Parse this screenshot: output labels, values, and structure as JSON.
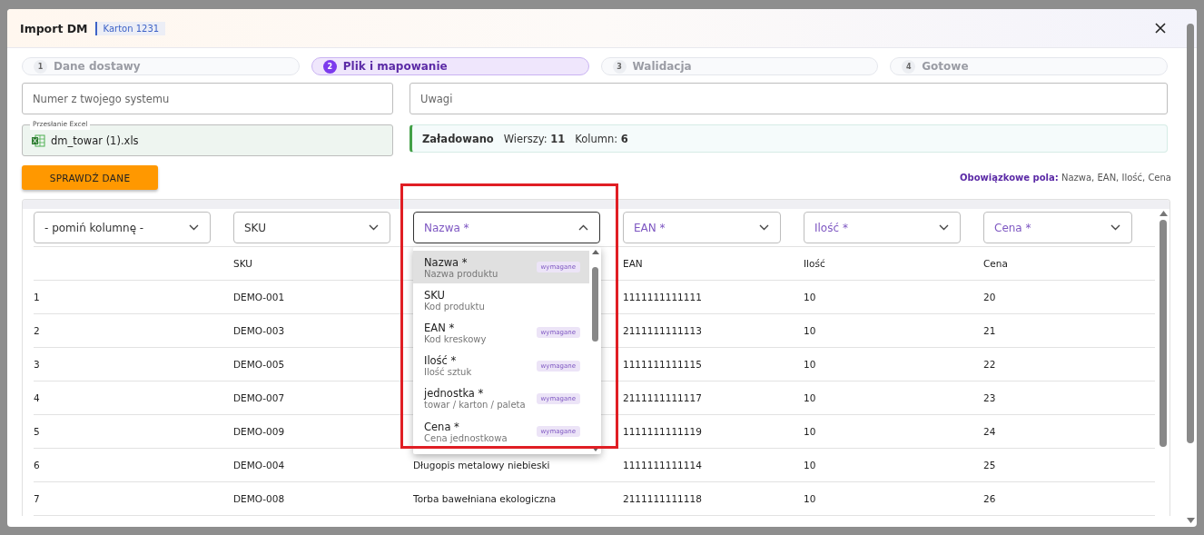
{
  "dialog": {
    "title": "Import DM",
    "badge": "Karton 1231"
  },
  "steps": [
    {
      "number": "1",
      "label": "Dane dostawy",
      "selected": false
    },
    {
      "number": "2",
      "label": "Plik i mapowanie",
      "selected": true
    },
    {
      "number": "3",
      "label": "Walidacja",
      "selected": false
    },
    {
      "number": "4",
      "label": "Gotowe",
      "selected": false
    }
  ],
  "order_number": {
    "placeholder": "Numer z twojego systemu"
  },
  "notes": {
    "placeholder": "Uwagi"
  },
  "upload": {
    "legend": "Przesłanie Excel",
    "filename": "dm_towar (1).xls"
  },
  "status": {
    "label": "Załadowano",
    "rows_label": "Wierszy:",
    "rows": "11",
    "cols_label": "Kolumn:",
    "cols": "6"
  },
  "check_button": "SPRAWDŹ DANE",
  "required_note": {
    "label": "Obowiązkowe pola:",
    "fields": "Nazwa, EAN, Ilość, Cena"
  },
  "mapping": [
    {
      "value": "- pomiń kolumnę -",
      "required": false,
      "expanded": false
    },
    {
      "value": "SKU",
      "required": false,
      "expanded": false,
      "header": "SKU"
    },
    {
      "value": "Nazwa *",
      "required": true,
      "expanded": true
    },
    {
      "value": "EAN *",
      "required": true,
      "expanded": false,
      "header": "EAN"
    },
    {
      "value": "Ilość *",
      "required": true,
      "expanded": false,
      "header": "Ilość"
    },
    {
      "value": "Cena *",
      "required": true,
      "expanded": false,
      "header": "Cena"
    }
  ],
  "dropdown_options": [
    {
      "label": "Nazwa *",
      "hint": "Nazwa produktu",
      "badge": "wymagane",
      "selected": true
    },
    {
      "label": "SKU",
      "hint": "Kod produktu",
      "selected": false
    },
    {
      "label": "EAN *",
      "hint": "Kod kreskowy",
      "badge": "wymagane",
      "selected": false
    },
    {
      "label": "Ilość *",
      "hint": "Ilość sztuk",
      "badge": "wymagane",
      "selected": false
    },
    {
      "label": "jednostka *",
      "hint": "towar / karton / paleta",
      "badge": "wymagane",
      "selected": false
    },
    {
      "label": "Cena *",
      "hint": "Cena jednostkowa",
      "badge": "wymagane",
      "selected": false
    }
  ],
  "table": {
    "rows": [
      [
        "1",
        "DEMO-001",
        "",
        "1111111111111",
        "10",
        "20"
      ],
      [
        "2",
        "DEMO-003",
        "",
        "2111111111113",
        "10",
        "21"
      ],
      [
        "3",
        "DEMO-005",
        "",
        "1111111111115",
        "10",
        "22"
      ],
      [
        "4",
        "DEMO-007",
        "",
        "2111111111117",
        "10",
        "23"
      ],
      [
        "5",
        "DEMO-009",
        "",
        "1111111111119",
        "10",
        "24"
      ],
      [
        "6",
        "DEMO-004",
        "Długopis metalowy niebieski",
        "1111111111114",
        "10",
        "25"
      ],
      [
        "7",
        "DEMO-008",
        "Torba bawełniana ekologiczna",
        "2111111111118",
        "10",
        "26"
      ]
    ]
  }
}
